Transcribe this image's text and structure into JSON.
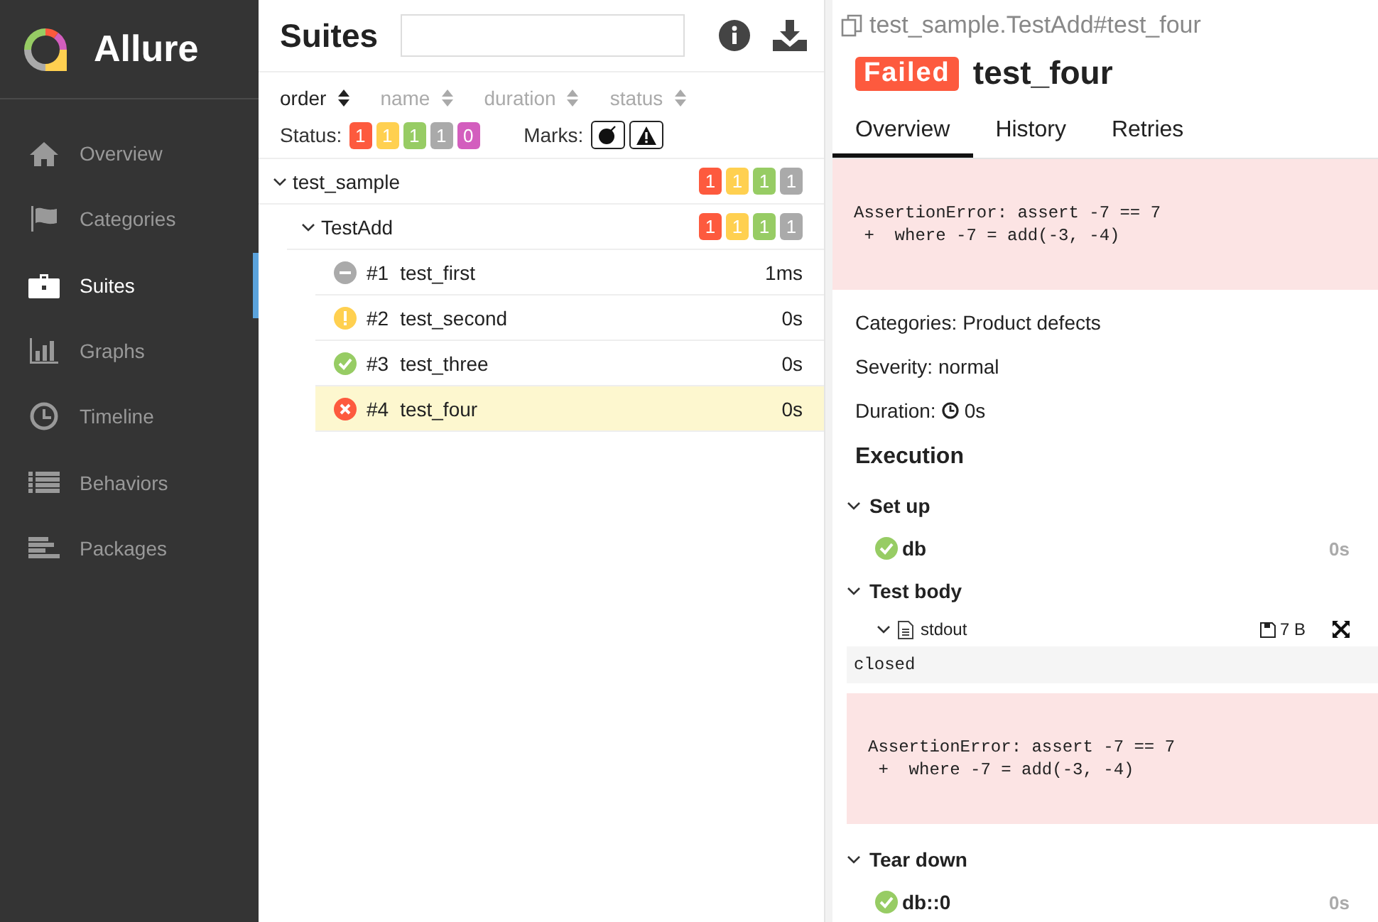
{
  "brand": {
    "name": "Allure"
  },
  "nav": [
    {
      "label": "Overview",
      "kind": "home",
      "selected": false
    },
    {
      "label": "Categories",
      "kind": "flag",
      "selected": false
    },
    {
      "label": "Suites",
      "kind": "briefcase",
      "selected": true
    },
    {
      "label": "Graphs",
      "kind": "bars",
      "selected": false
    },
    {
      "label": "Timeline",
      "kind": "clock",
      "selected": false
    },
    {
      "label": "Behaviors",
      "kind": "list",
      "selected": false
    },
    {
      "label": "Packages",
      "kind": "packages",
      "selected": false
    }
  ],
  "suites": {
    "title": "Suites",
    "sort": [
      {
        "label": "order",
        "selected": true
      },
      {
        "label": "name",
        "selected": false
      },
      {
        "label": "duration",
        "selected": false
      },
      {
        "label": "status",
        "selected": false
      }
    ],
    "status_label": "Status:",
    "status_counts": [
      {
        "value": "1",
        "color": "#fd5a3e"
      },
      {
        "value": "1",
        "color": "#ffd050"
      },
      {
        "value": "1",
        "color": "#97cc64"
      },
      {
        "value": "1",
        "color": "#aaaaaa"
      },
      {
        "value": "0",
        "color": "#d35ebe"
      }
    ],
    "marks_label": "Marks:",
    "marks": [
      {
        "kind": "bomb"
      },
      {
        "kind": "warning"
      }
    ],
    "tree": [
      {
        "name": "test_sample",
        "expanded": true,
        "counts": [
          {
            "value": "1",
            "color": "#fd5a3e"
          },
          {
            "value": "1",
            "color": "#ffd050"
          },
          {
            "value": "1",
            "color": "#97cc64"
          },
          {
            "value": "1",
            "color": "#aaaaaa"
          }
        ],
        "children": [
          {
            "name": "TestAdd",
            "expanded": true,
            "counts": [
              {
                "value": "1",
                "color": "#fd5a3e"
              },
              {
                "value": "1",
                "color": "#ffd050"
              },
              {
                "value": "1",
                "color": "#97cc64"
              },
              {
                "value": "1",
                "color": "#aaaaaa"
              }
            ],
            "tests": [
              {
                "kind": "skipped",
                "order": "#1",
                "name": "test_first",
                "duration": "1ms",
                "selected": false
              },
              {
                "kind": "broken",
                "order": "#2",
                "name": "test_second",
                "duration": "0s",
                "selected": false
              },
              {
                "kind": "passed",
                "order": "#3",
                "name": "test_three",
                "duration": "0s",
                "selected": false
              },
              {
                "kind": "failed",
                "order": "#4",
                "name": "test_four",
                "duration": "0s",
                "selected": true
              }
            ]
          }
        ]
      }
    ]
  },
  "detail": {
    "path": "test_sample.TestAdd#test_four",
    "status": "Failed",
    "title": "test_four",
    "tabs": [
      {
        "label": "Overview",
        "selected": true
      },
      {
        "label": "History",
        "selected": false
      },
      {
        "label": "Retries",
        "selected": false
      }
    ],
    "error": "AssertionError: assert -7 == 7\n +  where -7 = add(-3, -4)",
    "fields": [
      {
        "kind": "text",
        "label": "Categories:",
        "value": "Product defects"
      },
      {
        "kind": "text",
        "label": "Severity:",
        "value": "normal"
      },
      {
        "kind": "duration",
        "label": "Duration:",
        "value": "0s"
      }
    ],
    "execution_title": "Execution",
    "stages": [
      {
        "title": "Set up",
        "expanded": true,
        "items": [
          {
            "kind": "step",
            "color": "#97cc64",
            "name": "db",
            "duration": "0s"
          }
        ]
      },
      {
        "title": "Test body",
        "expanded": true,
        "items": [
          {
            "kind": "attachment",
            "name": "stdout",
            "size": "7 B",
            "expanded": true,
            "content": "closed"
          },
          {
            "kind": "error",
            "text": "AssertionError: assert -7 == 7\n +  where -7 = add(-3, -4)"
          }
        ]
      },
      {
        "title": "Tear down",
        "expanded": true,
        "items": [
          {
            "kind": "step",
            "color": "#97cc64",
            "name": "db::0",
            "duration": "0s"
          }
        ]
      }
    ]
  }
}
